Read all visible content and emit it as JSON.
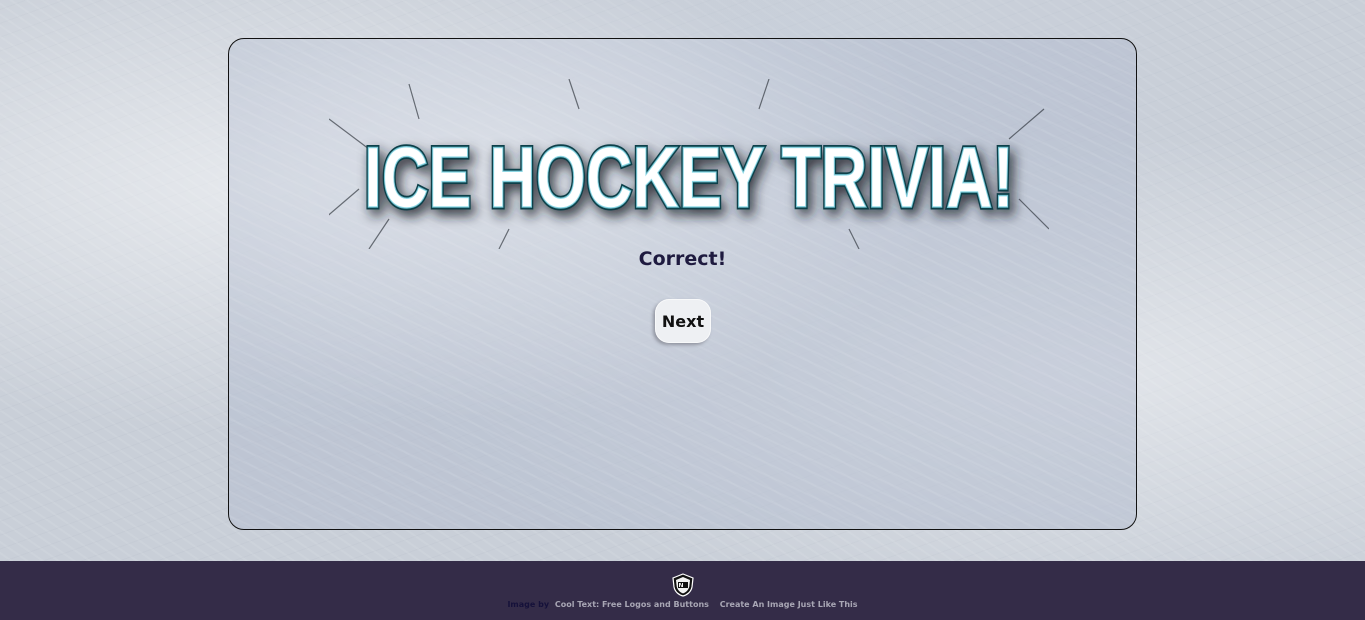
{
  "logo": {
    "text": "ICE HOCKEY TRIVIA!"
  },
  "quiz": {
    "status_text": "Correct!",
    "next_label": "Next"
  },
  "footer": {
    "image_by": "Image by",
    "link_cooltext": "Cool Text: Free Logos and Buttons",
    "link_create": "Create An Image Just Like This"
  },
  "colors": {
    "status_text": "#1e1a3f",
    "footer_bg": "#342c48",
    "logo_fill": "#ffffff",
    "logo_stroke": "#0f3f4a",
    "logo_glow": "#7fd6e6"
  },
  "icons": {
    "footer_logo": "nhl-shield-icon"
  }
}
